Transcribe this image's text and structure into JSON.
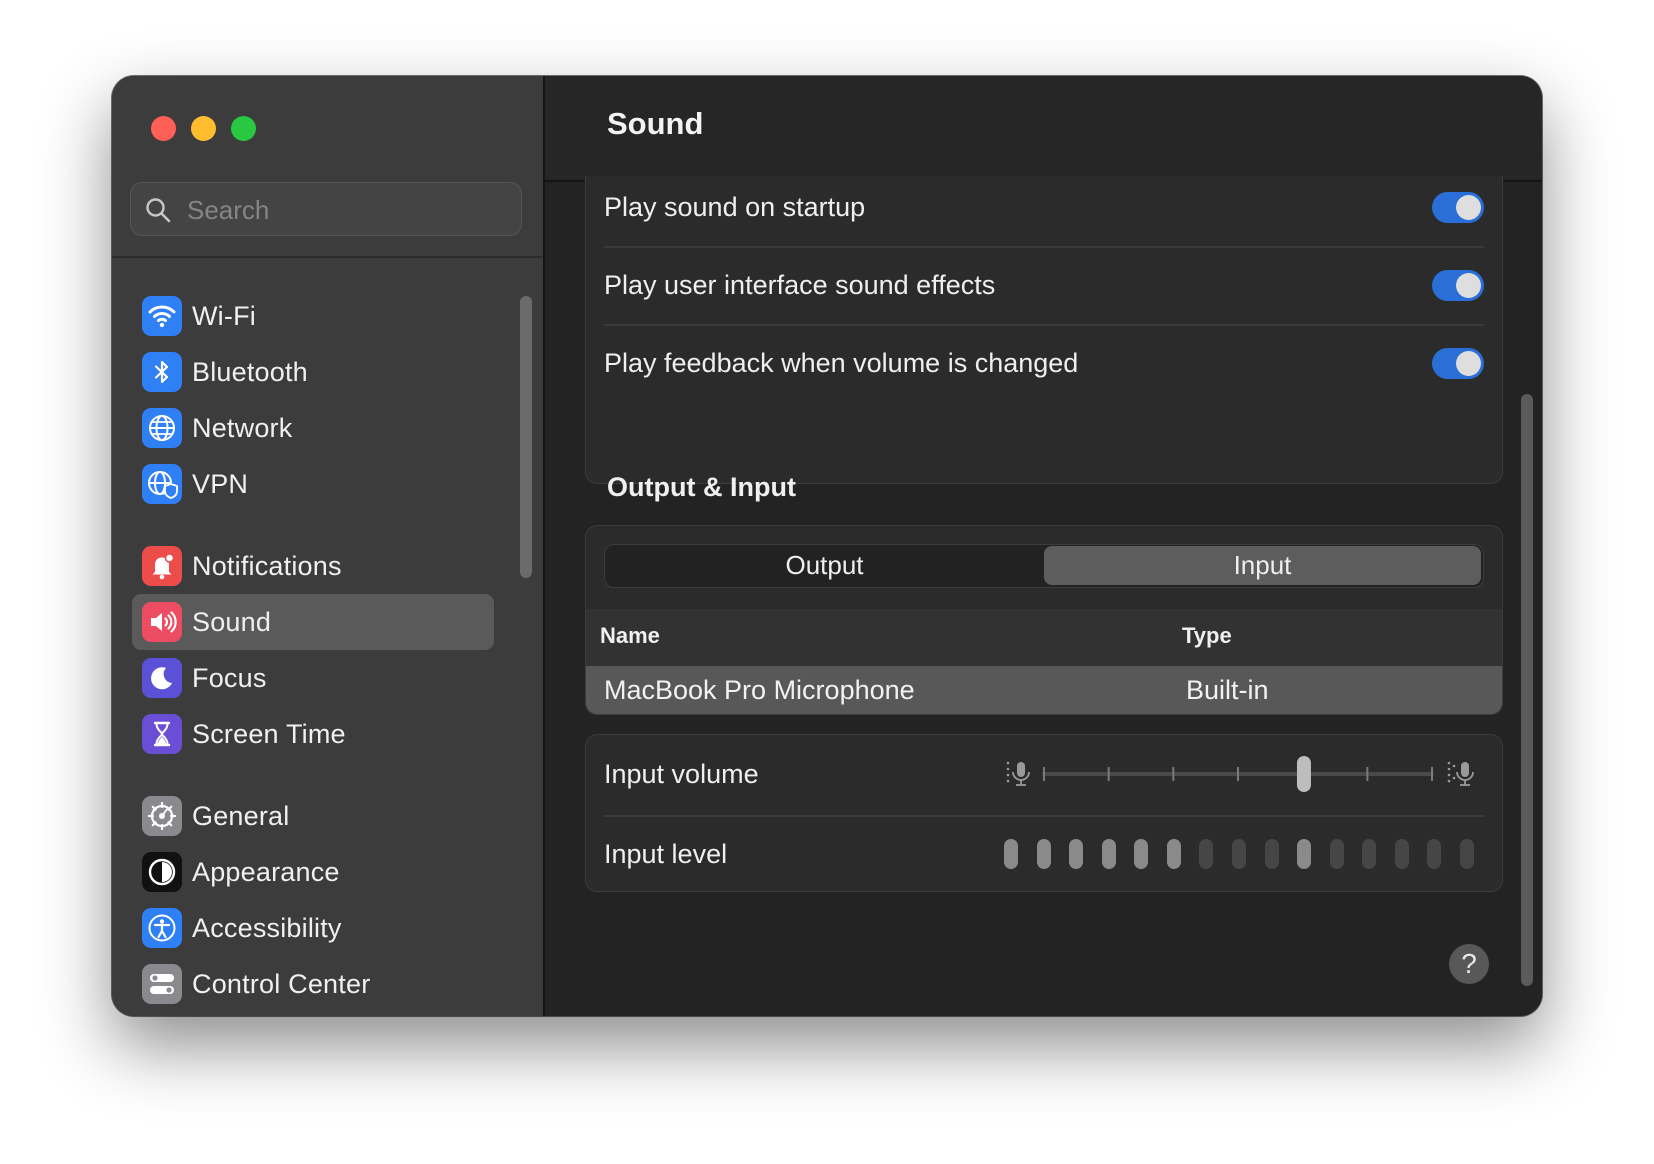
{
  "window": {
    "title": "Sound",
    "controls": [
      "close",
      "minimize",
      "zoom"
    ]
  },
  "search": {
    "placeholder": "Search",
    "value": ""
  },
  "sidebar": {
    "selected": "Sound",
    "items": [
      {
        "label": "Wi-Fi",
        "icon": "wifi-icon",
        "color": "#2f7ff5"
      },
      {
        "label": "Bluetooth",
        "icon": "bluetooth-icon",
        "color": "#2f7ff5"
      },
      {
        "label": "Network",
        "icon": "globe-icon",
        "color": "#2f7ff5"
      },
      {
        "label": "VPN",
        "icon": "vpn-globe-icon",
        "color": "#2f7ff5"
      },
      {
        "label": "Notifications",
        "icon": "bell-icon",
        "color": "#ec4d4a"
      },
      {
        "label": "Sound",
        "icon": "speaker-icon",
        "color": "#ec4d62"
      },
      {
        "label": "Focus",
        "icon": "moon-icon",
        "color": "#5b51d6"
      },
      {
        "label": "Screen Time",
        "icon": "hourglass-icon",
        "color": "#6a4fd6"
      },
      {
        "label": "General",
        "icon": "gear-icon",
        "color": "#8a8a8e"
      },
      {
        "label": "Appearance",
        "icon": "appearance-icon",
        "color": "#111111"
      },
      {
        "label": "Accessibility",
        "icon": "accessibility-icon",
        "color": "#2f7ff5"
      },
      {
        "label": "Control Center",
        "icon": "control-center-icon",
        "color": "#8a8a8e"
      }
    ]
  },
  "settings": {
    "startup_label": "Play sound on startup",
    "startup_on": true,
    "ui_effects_label": "Play user interface sound effects",
    "ui_effects_on": true,
    "feedback_label": "Play feedback when volume is changed",
    "feedback_on": true
  },
  "output_input": {
    "title": "Output & Input",
    "tabs": [
      "Output",
      "Input"
    ],
    "selected_tab": "Input",
    "columns": [
      "Name",
      "Type"
    ],
    "devices": [
      {
        "name": "MacBook Pro Microphone",
        "type": "Built-in",
        "selected": true
      }
    ]
  },
  "input": {
    "volume_label": "Input volume",
    "volume_fraction": 0.67,
    "level_label": "Input level",
    "level_bars_total": 15,
    "level_bars_active": [
      0,
      1,
      2,
      3,
      4,
      5,
      9
    ]
  },
  "help_label": "?",
  "colors": {
    "accent": "#2a6ed8",
    "sidebar_bg": "#3c3c3c",
    "main_bg": "#232323",
    "selection": "#5a5a5a"
  }
}
